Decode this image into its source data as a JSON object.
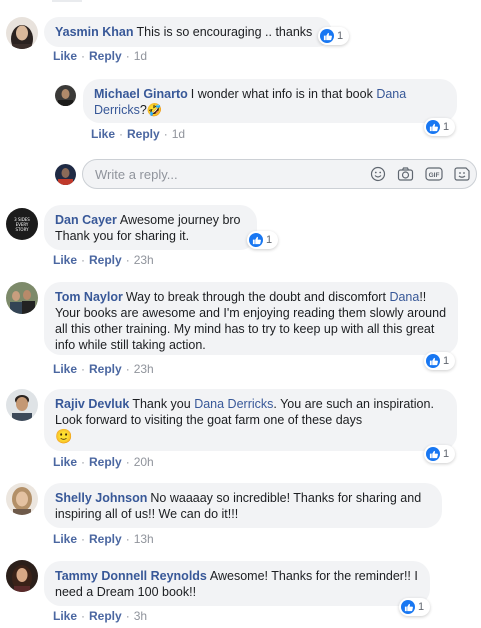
{
  "actions": {
    "like": "Like",
    "reply": "Reply",
    "separator": "·"
  },
  "reply_box": {
    "placeholder": "Write a reply..."
  },
  "comments": [
    {
      "author": "Yasmin Khan",
      "text": "This is so encouraging .. thanks",
      "time": "1d",
      "reactions": "1"
    },
    {
      "author": "Michael Ginarto",
      "text_before": "I wonder what info is in that book",
      "mention": "Dana Derricks",
      "text_after": "?🤣",
      "time": "1d",
      "reactions": "1"
    },
    {
      "author": "Dan Cayer",
      "text": "Awesome journey bro Thank you for sharing it.",
      "time": "23h",
      "reactions": "1",
      "avatar_text": [
        "3 SIDES",
        "EVERY",
        "STORY"
      ]
    },
    {
      "author": "Tom Naylor",
      "text_before": "Way to break through the doubt and discomfort",
      "mention": "Dana",
      "text_after": "!! Your books are awesome and I'm enjoying reading them slowly around all this other training. My mind has to try to keep up with all this great info while still taking action.",
      "time": "23h",
      "reactions": "1"
    },
    {
      "author": "Rajiv Devluk",
      "text_before": "Thank you",
      "mention": "Dana Derricks",
      "text_after": ". You are such an inspiration. Look forward to visiting the goat farm one of these days",
      "emoji": "🙂",
      "time": "20h",
      "reactions": "1"
    },
    {
      "author": "Shelly Johnson",
      "text": "No waaaay so incredible! Thanks for sharing and inspiring all of us!! We can do it!!!",
      "time": "13h",
      "reactions": "1"
    },
    {
      "author": "Tammy Donnell Reynolds",
      "text": "Awesome! Thanks for the reminder!! I need a Dream 100 book!!",
      "time": "3h",
      "reactions": "1"
    }
  ],
  "colors": {
    "link": "#385898",
    "action": "#4b67a1",
    "bubble": "#f2f3f5",
    "like_blue": "#1877f2",
    "meta": "#90949c"
  }
}
